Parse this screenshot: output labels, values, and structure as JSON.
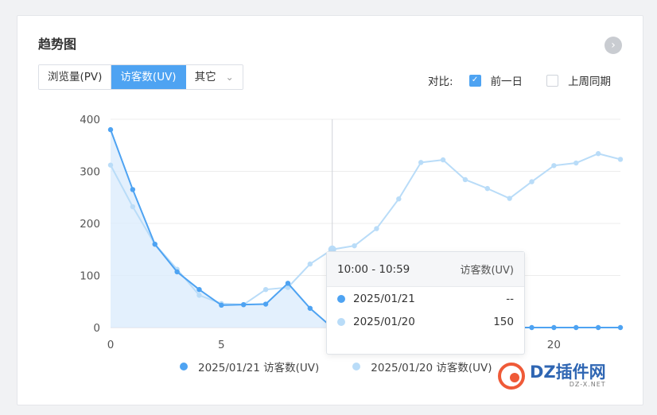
{
  "header": {
    "title": "趋势图"
  },
  "tabs": [
    {
      "label": "浏览量(PV)"
    },
    {
      "label": "访客数(UV)"
    },
    {
      "label": "其它"
    }
  ],
  "compare": {
    "label": "对比:",
    "options": [
      {
        "label": "前一日",
        "checked": true
      },
      {
        "label": "上周同期",
        "checked": false
      }
    ]
  },
  "tooltip": {
    "time_range": "10:00 - 10:59",
    "metric": "访客数(UV)",
    "rows": [
      {
        "date": "2025/01/21",
        "value": "--",
        "color": "#4ea3f2"
      },
      {
        "date": "2025/01/20",
        "value": "150",
        "color": "#b9dcf8"
      }
    ]
  },
  "legend": [
    {
      "label": "2025/01/21 访客数(UV)",
      "color": "#4ea3f2"
    },
    {
      "label": "2025/01/20 访客数(UV)",
      "color": "#b9dcf8"
    }
  ],
  "watermark": {
    "text": "DZ插件网",
    "sub": "DZ-X.NET"
  },
  "colors": {
    "accent": "#4ea3f2",
    "compare": "#b9dcf8",
    "hoverLine": "#d0d3d8",
    "grid": "#ececec"
  },
  "chart_data": {
    "type": "line",
    "title": "趋势图",
    "xlabel": "",
    "ylabel": "",
    "x": [
      0,
      1,
      2,
      3,
      4,
      5,
      6,
      7,
      8,
      9,
      10,
      11,
      12,
      13,
      14,
      15,
      16,
      17,
      18,
      19,
      20,
      21,
      22,
      23
    ],
    "xticks": [
      0,
      5,
      10,
      15,
      20
    ],
    "yticks": [
      0,
      100,
      200,
      300,
      400
    ],
    "xlim": [
      0,
      23
    ],
    "ylim": [
      0,
      400
    ],
    "grid": true,
    "legend_position": "bottom",
    "hover_x": 10,
    "series": [
      {
        "name": "2025/01/21 访客数(UV)",
        "values": [
          380,
          265,
          160,
          107,
          73,
          43,
          44,
          45,
          85,
          37,
          0,
          0,
          0,
          0,
          0,
          0,
          0,
          0,
          0,
          0,
          0,
          0,
          0,
          0
        ],
        "color": "#4ea3f2",
        "area": true
      },
      {
        "name": "2025/01/20 访客数(UV)",
        "values": [
          312,
          232,
          160,
          112,
          62,
          46,
          44,
          73,
          77,
          122,
          150,
          157,
          190,
          247,
          317,
          322,
          284,
          267,
          248,
          280,
          311,
          316,
          334,
          323
        ],
        "color": "#b9dcf8",
        "area": false
      }
    ]
  }
}
